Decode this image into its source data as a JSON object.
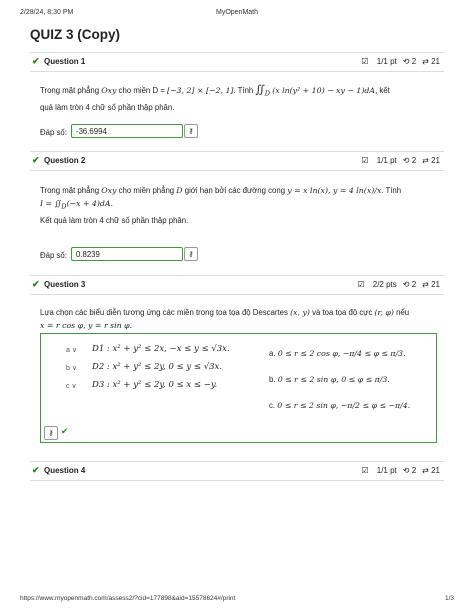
{
  "header": {
    "datetime": "2/28/24, 8:30 PM",
    "site": "MyOpenMath"
  },
  "title": "QUIZ 3 (Copy)",
  "questions": [
    {
      "label": "Question 1",
      "score": "1/1 pt",
      "retries": "2",
      "attempts": "21"
    },
    {
      "label": "Question 2",
      "score": "1/1 pt",
      "retries": "2",
      "attempts": "21"
    },
    {
      "label": "Question 3",
      "score": "2/2 pts",
      "retries": "2",
      "attempts": "21"
    },
    {
      "label": "Question 4",
      "score": "1/1 pt",
      "retries": "2",
      "attempts": "21"
    }
  ],
  "q1": {
    "text_a": "Trong mặt phẳng ",
    "text_b": " cho miền D = ",
    "text_c": ". Tính ",
    "text_d": ", kết",
    "text_e": "quả làm tròn 4 chữ số phần thập phân.",
    "answer_label": "Đáp số:",
    "answer": "-36.6994"
  },
  "q2": {
    "text_a": "Trong mặt phẳng ",
    "text_b": " cho miền phẳng ",
    "text_c": " giới hạn bởi các đường cong ",
    "text_d": ". Tính",
    "text_e": "Kết quả làm tròn 4 chữ số phần thập phân.",
    "answer_label": "Đáp số:",
    "answer": "0.8239"
  },
  "q3": {
    "text_a": "Lựa chọn các biểu diễn tương ứng các miền trong toa tọa độ Descartes ",
    "text_b": " và toa tọa độ cực ",
    "text_c": " nếu",
    "left": [
      {
        "sel": "a",
        "expr": "D1 : x² + y² ≤ 2x, −x ≤ y ≤ √3x."
      },
      {
        "sel": "b",
        "expr": "D2 : x² + y² ≤ 2y, 0 ≤ y ≤ √3x."
      },
      {
        "sel": "c",
        "expr": "D3 : x² + y² ≤ 2y, 0 ≤ x ≤ −y."
      }
    ],
    "right": [
      {
        "tag": "a.",
        "expr": "0 ≤ r ≤ 2 cos φ, −π/4 ≤ φ ≤ π/3."
      },
      {
        "tag": "b.",
        "expr": "0 ≤ r ≤ 2 sin φ, 0 ≤ φ ≤ π/3."
      },
      {
        "tag": "c.",
        "expr": "0 ≤ r ≤ 2 sin φ, −π/2 ≤ φ ≤ −π/4."
      }
    ]
  },
  "footer": {
    "url": "https://www.myopenmath.com/assess2/?cid=177898&aid=15578624#/print",
    "page": "1/3"
  },
  "colors": {
    "correct": "#1a8a1a",
    "border": "#3c9a3c"
  }
}
